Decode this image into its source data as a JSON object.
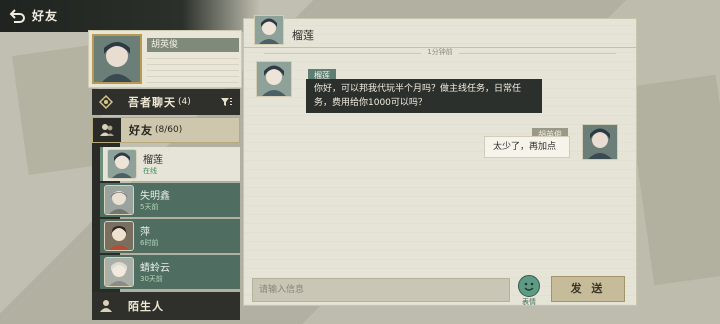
{
  "header": {
    "back_label": "好友"
  },
  "self": {
    "name": "胡英俊"
  },
  "sidebar": {
    "chat_row": {
      "label": "吾者聊天",
      "count": "(4)"
    },
    "friends_row": {
      "label": "好友",
      "count": "(8/60)"
    },
    "strangers_row": {
      "label": "陌生人"
    },
    "friends": [
      {
        "name": "榴莲",
        "status": "在线"
      },
      {
        "name": "失明鑫",
        "status": "5天前"
      },
      {
        "name": "萍",
        "status": "6时前"
      },
      {
        "name": "蜻蛉云",
        "status": "30天前"
      }
    ]
  },
  "chat": {
    "title": "榴莲",
    "time_divider": "1分钟前",
    "messages": [
      {
        "sender": "榴莲",
        "text": "你好，可以邦我代玩半个月吗？做主线任务，日常任务，费用给你1000可以吗？"
      },
      {
        "sender": "胡英俊",
        "text": "太少了，再加点"
      }
    ]
  },
  "composer": {
    "placeholder": "请输入信息",
    "emoji_label": "表情",
    "send_label": "发 送"
  }
}
